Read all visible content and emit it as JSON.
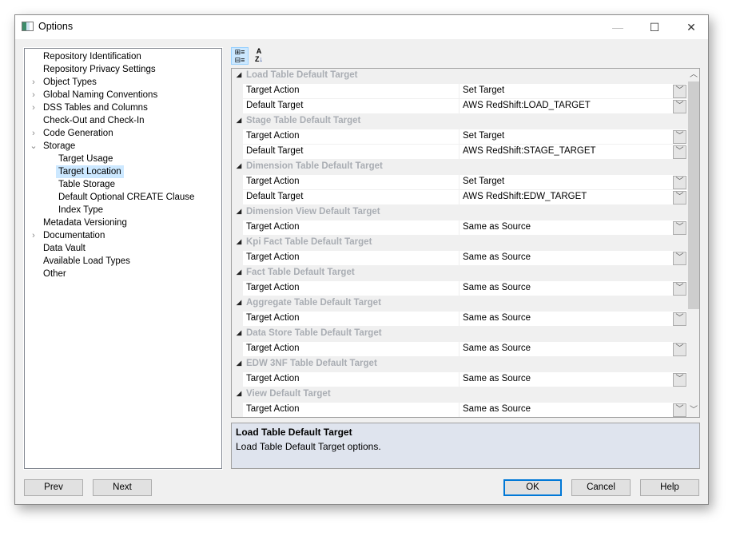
{
  "window": {
    "title": "Options",
    "minimize": "—",
    "maximize": "☐",
    "close": "✕"
  },
  "tree": [
    {
      "label": "Repository Identification",
      "level": 0,
      "expander": false
    },
    {
      "label": "Repository Privacy Settings",
      "level": 0,
      "expander": false
    },
    {
      "label": "Object Types",
      "level": 0,
      "expander": "collapsed"
    },
    {
      "label": "Global Naming Conventions",
      "level": 0,
      "expander": "collapsed"
    },
    {
      "label": "DSS Tables and Columns",
      "level": 0,
      "expander": "collapsed"
    },
    {
      "label": "Check-Out and Check-In",
      "level": 0,
      "expander": false
    },
    {
      "label": "Code Generation",
      "level": 0,
      "expander": "collapsed"
    },
    {
      "label": "Storage",
      "level": 0,
      "expander": "expanded"
    },
    {
      "label": "Target Usage",
      "level": 1,
      "expander": false
    },
    {
      "label": "Target Location",
      "level": 1,
      "expander": false,
      "selected": true
    },
    {
      "label": "Table Storage",
      "level": 1,
      "expander": false
    },
    {
      "label": "Default Optional CREATE Clause",
      "level": 1,
      "expander": false
    },
    {
      "label": "Index Type",
      "level": 1,
      "expander": false
    },
    {
      "label": "Metadata Versioning",
      "level": 0,
      "expander": false
    },
    {
      "label": "Documentation",
      "level": 0,
      "expander": "collapsed"
    },
    {
      "label": "Data Vault",
      "level": 0,
      "expander": false
    },
    {
      "label": "Available Load Types",
      "level": 0,
      "expander": false
    },
    {
      "label": "Other",
      "level": 0,
      "expander": false
    }
  ],
  "toolbar": {
    "categorized_icon": "categorized-icon",
    "alphabetical_icon": "sort-az-icon"
  },
  "grid": [
    {
      "category": "Load Table Default Target",
      "props": [
        {
          "name": "Target Action",
          "value": "Set Target"
        },
        {
          "name": "Default Target",
          "value": "AWS RedShift:LOAD_TARGET"
        }
      ]
    },
    {
      "category": "Stage Table Default Target",
      "props": [
        {
          "name": "Target Action",
          "value": "Set Target"
        },
        {
          "name": "Default Target",
          "value": "AWS RedShift:STAGE_TARGET"
        }
      ]
    },
    {
      "category": "Dimension Table Default Target",
      "props": [
        {
          "name": "Target Action",
          "value": "Set Target"
        },
        {
          "name": "Default Target",
          "value": "AWS RedShift:EDW_TARGET"
        }
      ]
    },
    {
      "category": "Dimension View Default Target",
      "props": [
        {
          "name": "Target Action",
          "value": "Same as Source"
        }
      ]
    },
    {
      "category": "Kpi Fact Table Default Target",
      "props": [
        {
          "name": "Target Action",
          "value": "Same as Source"
        }
      ]
    },
    {
      "category": "Fact Table Default Target",
      "props": [
        {
          "name": "Target Action",
          "value": "Same as Source"
        }
      ]
    },
    {
      "category": "Aggregate Table Default Target",
      "props": [
        {
          "name": "Target Action",
          "value": "Same as Source"
        }
      ]
    },
    {
      "category": "Data Store Table Default Target",
      "props": [
        {
          "name": "Target Action",
          "value": "Same as Source"
        }
      ]
    },
    {
      "category": "EDW 3NF Table Default Target",
      "props": [
        {
          "name": "Target Action",
          "value": "Same as Source"
        }
      ]
    },
    {
      "category": "View Default Target",
      "props": [
        {
          "name": "Target Action",
          "value": "Same as Source"
        }
      ]
    }
  ],
  "scroll": {
    "position_fraction": 0
  },
  "description": {
    "title": "Load Table Default Target",
    "text": "Load Table Default Target options."
  },
  "buttons": {
    "prev": "Prev",
    "next": "Next",
    "ok": "OK",
    "cancel": "Cancel",
    "help": "Help"
  }
}
